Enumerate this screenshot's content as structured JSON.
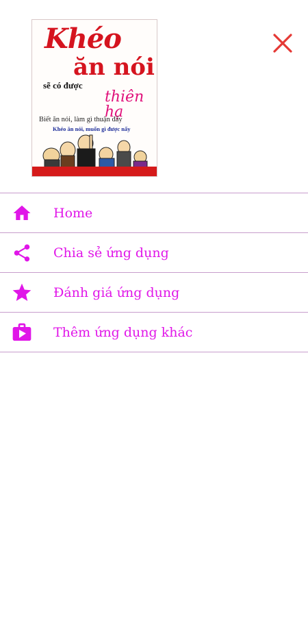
{
  "header": {
    "cover": {
      "title_line1": "Khéo",
      "title_line2": "ăn nói",
      "subtitle_line1": "sẽ có được",
      "subtitle_line2": "thiên hạ",
      "tagline1": "Biết ăn nói, làm gì thuận đấy",
      "tagline2": "Khéo ăn nói, muốn gì được nấy"
    },
    "close_icon": "close-icon"
  },
  "menu": {
    "items": [
      {
        "label": "Home",
        "icon": "home-icon"
      },
      {
        "label": "Chia sẻ ứng dụng",
        "icon": "share-icon"
      },
      {
        "label": "Đánh giá ứng dụng",
        "icon": "star-icon"
      },
      {
        "label": "Thêm ứng dụng khác",
        "icon": "store-icon"
      }
    ]
  },
  "colors": {
    "accent": "#e016e8",
    "close": "#e53935",
    "divider": "#c79ccc"
  }
}
